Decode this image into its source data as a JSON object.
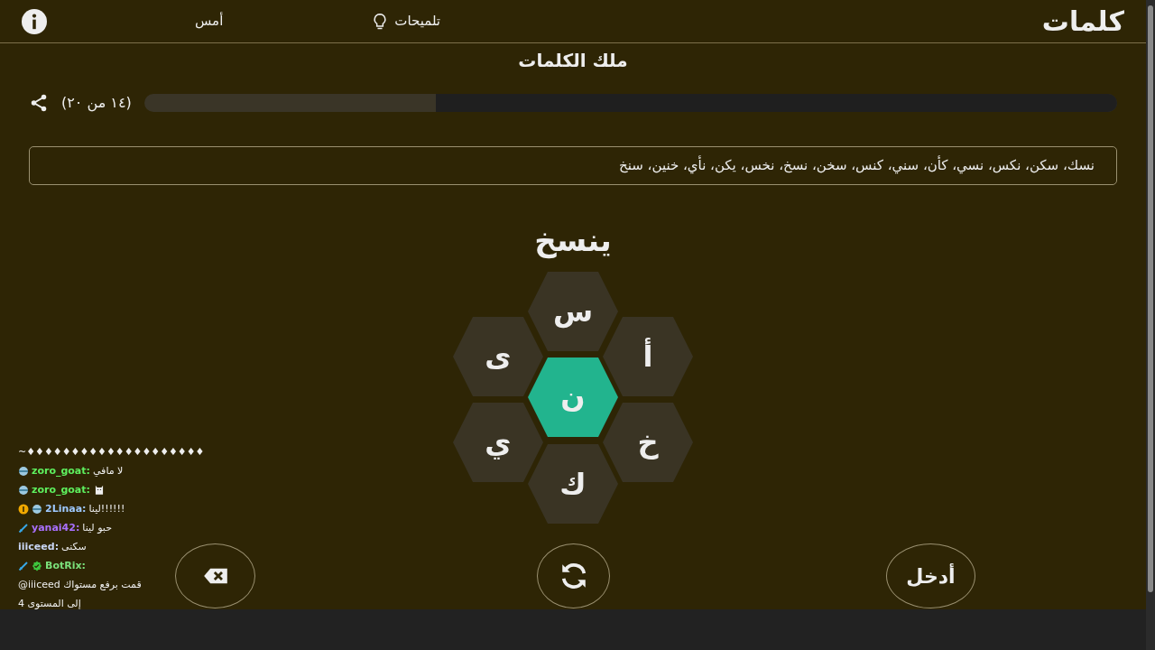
{
  "header": {
    "logo": "كلمات",
    "hints_label": "تلميحات",
    "yesterday_label": "أمس"
  },
  "title": "ملك الكلمات",
  "progress": {
    "level": 0.7,
    "reading": "(١٤ من ٢٠)"
  },
  "found_words": "نسك، سكن، نكس، نسي، كأن، سني، كنس، سخن، نسخ، نخس، يكن، نأي، خنين، سنخ",
  "current_word": "ينسخ",
  "letters": [
    {
      "letter": "س",
      "kind": "outer"
    },
    {
      "letter": "أ",
      "kind": "outer"
    },
    {
      "letter": "خ",
      "kind": "outer"
    },
    {
      "letter": "ك",
      "kind": "outer"
    },
    {
      "letter": "ي",
      "kind": "outer"
    },
    {
      "letter": "ى",
      "kind": "outer"
    },
    {
      "letter": "ن",
      "kind": "center"
    }
  ],
  "enter_label": "أدخل",
  "chat": [
    {
      "kind": "message",
      "text": "~♦♦♦♦♦♦♦♦♦♦♦♦♦♦♦♦♦♦♦♦"
    },
    {
      "kind": "message",
      "badges": [
        {
          "kind": "globe"
        }
      ],
      "user": "zoro_goat:",
      "color": "#5ef05e",
      "text": "لا مافي"
    },
    {
      "kind": "emote",
      "badges": [
        {
          "kind": "globe"
        }
      ],
      "user": "zoro_goat:",
      "color": "#5ef05e"
    },
    {
      "kind": "message",
      "badges": [
        {
          "kind": "coin"
        },
        {
          "kind": "globe"
        }
      ],
      "user": "2Linaa:",
      "color": "#9ec9ff",
      "text": "لينا!!!!!!"
    },
    {
      "kind": "message",
      "badges": [
        {
          "kind": "sword"
        }
      ],
      "user": "yanai42:",
      "color": "#a970ff",
      "text": "حبو لينا"
    },
    {
      "kind": "message",
      "user": "iiiceed:",
      "color": "#c9d6f5",
      "text": "سكنى"
    },
    {
      "kind": "message",
      "badges": [
        {
          "kind": "sword"
        },
        {
          "kind": "verified"
        }
      ],
      "user": "BotRix:",
      "color": "#7be07b",
      "text": "@iiiceed قمت برفع مستواك إلى المستوى 4"
    }
  ]
}
